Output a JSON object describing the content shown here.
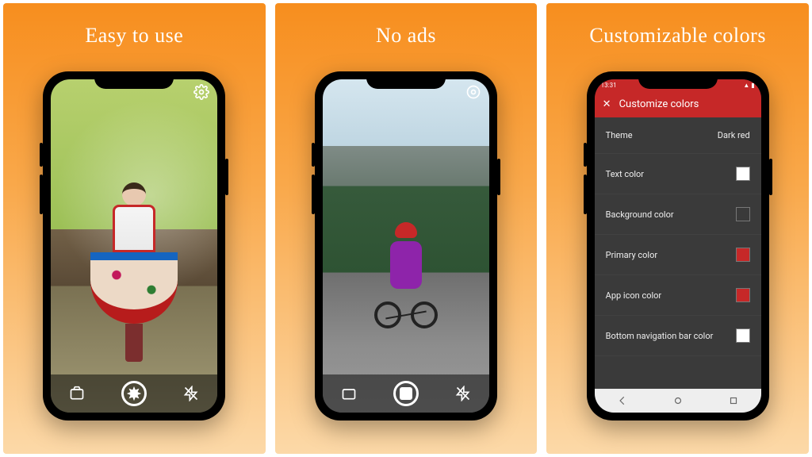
{
  "panels": [
    {
      "headline": "Easy to use"
    },
    {
      "headline": "No ads"
    },
    {
      "headline": "Customizable colors"
    }
  ],
  "camera": {
    "settings_icon": "gear",
    "toggle_icon": "switch-camera",
    "shutter_icon": "shutter",
    "flash_icon": "flash-off"
  },
  "settings": {
    "status_time": "13:31",
    "appbar_close": "✕",
    "appbar_title": "Customize colors",
    "rows": [
      {
        "label": "Theme",
        "value": "Dark red",
        "swatch": null
      },
      {
        "label": "Text color",
        "value": "",
        "swatch": "#ffffff"
      },
      {
        "label": "Background color",
        "value": "",
        "swatch": "#3a3a3a"
      },
      {
        "label": "Primary color",
        "value": "",
        "swatch": "#c62828"
      },
      {
        "label": "App icon color",
        "value": "",
        "swatch": "#c62828"
      },
      {
        "label": "Bottom navigation bar color",
        "value": "",
        "swatch": "#ffffff"
      }
    ]
  }
}
